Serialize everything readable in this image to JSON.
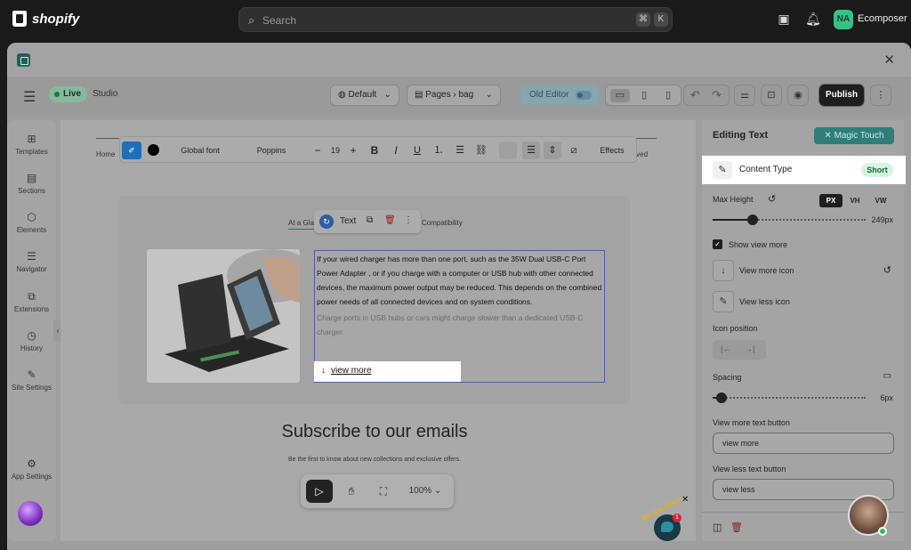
{
  "shopify": {
    "logo_text": "shopify",
    "search_placeholder": "Search",
    "kbd1": "⌘",
    "kbd2": "K",
    "avatar_initials": "NA",
    "store_name": "Ecomposer"
  },
  "editor": {
    "status": "Live",
    "mode": "Studio",
    "theme_select": "Default",
    "pages_label": "Pages",
    "page_name": "bag",
    "old_editor": "Old Editor",
    "publish": "Publish"
  },
  "sidebar": {
    "items": [
      {
        "label": "Templates",
        "icon": "templates-icon"
      },
      {
        "label": "Sections",
        "icon": "sections-icon"
      },
      {
        "label": "Elements",
        "icon": "elements-icon"
      },
      {
        "label": "Navigator",
        "icon": "navigator-icon"
      },
      {
        "label": "Extensions",
        "icon": "extensions-icon"
      },
      {
        "label": "History",
        "icon": "history-icon"
      },
      {
        "label": "Site Settings",
        "icon": "site-settings-icon"
      }
    ],
    "app_settings": "App Settings"
  },
  "canvas": {
    "nav_home": "Home",
    "nav_reserved": "erved",
    "format_bar": {
      "global_font": "Global font",
      "font_name": "Poppins",
      "font_size": "19",
      "effects": "Effects"
    },
    "tabs": {
      "first": "At a Gla",
      "last": "Compatibility"
    },
    "element_toolbar_label": "Text",
    "paragraph_main": "If your wired charger has more than one port, such as the 35W Dual USB-C Port Power Adapter , or if you charge with a computer or USB hub with other connected devices, the maximum power output may be reduced. This depends on the combined power needs of all connected devices and on system conditions.",
    "paragraph_faded": "Charge ports in USB hubs or cars might charge slower than a dedicated USB-C charger.",
    "view_more": "view more",
    "subscribe_title": "Subscribe to our emails",
    "subscribe_desc": "Be the first to know about new collections and exclusive offers.",
    "zoom": "100%"
  },
  "panel": {
    "title": "Editing Text",
    "magic_touch": "Magic Touch",
    "content_type_label": "Content Type",
    "content_type_value": "Short",
    "max_height_label": "Max Height",
    "units": [
      "PX",
      "VH",
      "VW"
    ],
    "max_height_value": "249px",
    "max_height_fraction": 0.26,
    "show_view_more": "Show view more",
    "view_more_icon": "View more icon",
    "view_less_icon": "View less icon",
    "icon_position": "Icon position",
    "spacing_label": "Spacing",
    "spacing_value": "6px",
    "spacing_fraction": 0.06,
    "view_more_text_label": "View more text button",
    "view_more_text_value": "view more",
    "view_less_text_label": "View less text button",
    "view_less_text_value": "view less"
  },
  "chat": {
    "we_are_here": "We Are Here!",
    "badge": "1"
  }
}
